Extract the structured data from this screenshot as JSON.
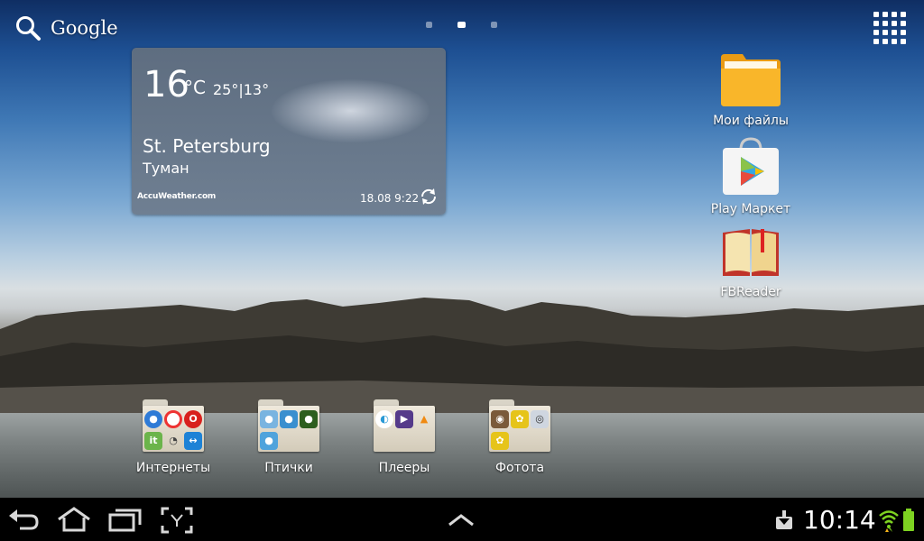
{
  "search": {
    "label": "Google"
  },
  "pager": {
    "pages": 3,
    "active": 1
  },
  "weather": {
    "temperature": "16",
    "unit": "°C",
    "range": "25°|13°",
    "city": "St. Petersburg",
    "condition": "Туман",
    "provider": "AccuWeather.com",
    "updated": "18.08 9:22"
  },
  "shortcuts": [
    {
      "label": "Мои файлы",
      "icon": "folder-icon"
    },
    {
      "label": "Play Маркет",
      "icon": "play-store-icon"
    },
    {
      "label": "FBReader",
      "icon": "book-icon"
    }
  ],
  "folders": [
    {
      "label": "Интернеты",
      "apps": [
        "browser-icon",
        "chrome-icon",
        "opera-icon",
        "icq-icon",
        "wifi-icon",
        "teamviewer-icon"
      ]
    },
    {
      "label": "Птички",
      "apps": [
        "angry-birds-icon",
        "angry-birds-rio-icon",
        "angry-birds-space-icon",
        "angry-birds-seasons-icon"
      ]
    },
    {
      "label": "Плееры",
      "apps": [
        "player-icon",
        "video-player-icon",
        "vlc-icon"
      ]
    },
    {
      "label": "Фотота",
      "apps": [
        "instagram-icon",
        "photo-editor-icon",
        "camera-icon",
        "gallery-icon"
      ]
    }
  ],
  "status": {
    "time": "10:14"
  },
  "colors": {
    "accent": "#f6b41a",
    "battery": "#7ed321",
    "widget": "#67778a"
  }
}
